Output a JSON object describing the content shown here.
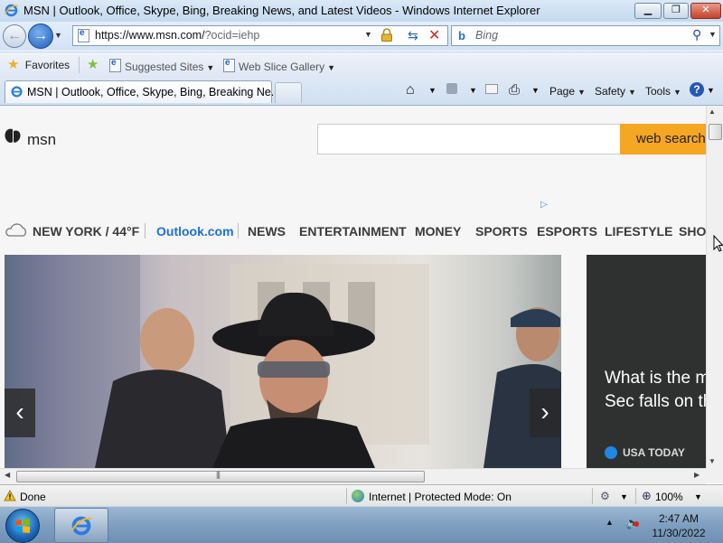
{
  "window": {
    "title": "MSN | Outlook, Office, Skype, Bing, Breaking News, and Latest Videos - Windows Internet Explorer",
    "minimize_label": "▁",
    "restore_label": "❐",
    "close_label": "✕"
  },
  "address_bar": {
    "url_main": "https://www.msn.com/",
    "url_tail": "?ocid=iehp"
  },
  "search_bar": {
    "placeholder": "Bing"
  },
  "favorites_bar": {
    "favorites_label": "Favorites",
    "suggested_sites_label": "Suggested Sites",
    "web_slice_label": "Web Slice Gallery"
  },
  "tab": {
    "title": "MSN | Outlook, Office, Skype, Bing, Breaking Ne..."
  },
  "command_bar": {
    "page_label": "Page",
    "safety_label": "Safety",
    "tools_label": "Tools"
  },
  "msn": {
    "logo_text": "msn",
    "search_button_label": "web search",
    "weather": "NEW YORK / 44°F",
    "nav_items": [
      "Outlook.com",
      "NEWS",
      "ENTERTAINMENT",
      "MONEY",
      "SPORTS",
      "ESPORTS",
      "LIFESTYLE",
      "SHOI"
    ],
    "hero_prev": "‹",
    "hero_next": "›",
    "side_card_title": "What is the m birthday? Sec falls on the lis",
    "side_card_source": "USA TODAY"
  },
  "status_bar": {
    "status": "Done",
    "zone": "Internet | Protected Mode: On",
    "zoom": "100%"
  },
  "taskbar": {
    "time": "2:47 AM",
    "date": "11/30/2022"
  },
  "colors": {
    "msn_accent": "#f5a623",
    "outlook_link": "#1e6fd9",
    "side_card_bg": "#2f3131"
  }
}
